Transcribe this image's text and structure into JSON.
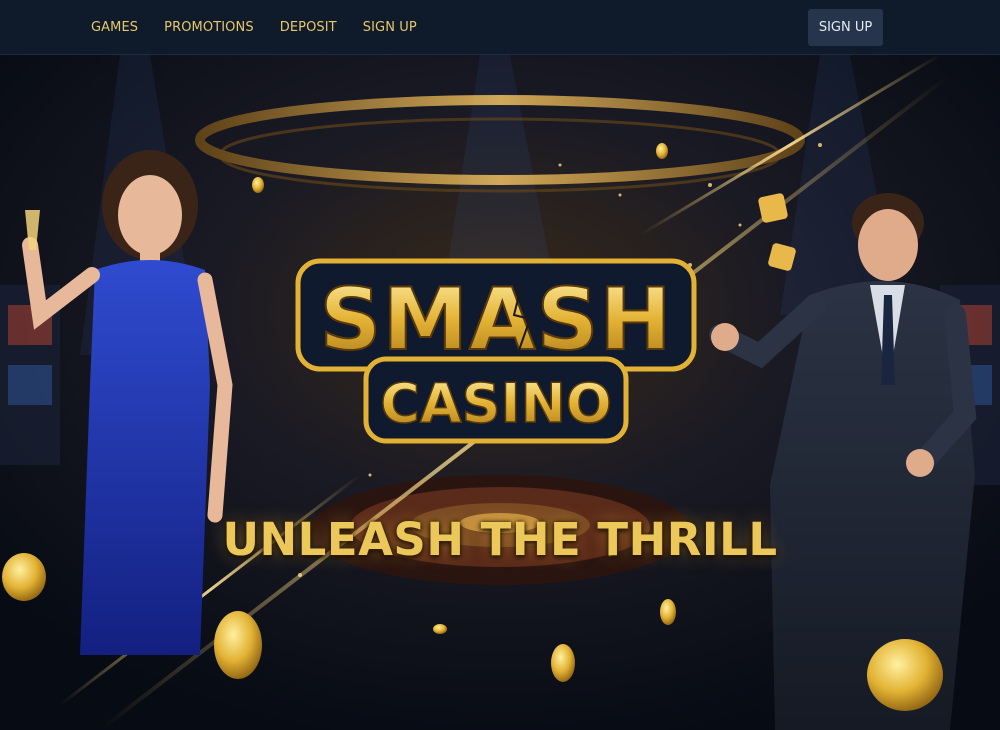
{
  "nav": {
    "items": [
      "GAMES",
      "PROMOTIONS",
      "DEPOSIT",
      "SIGN UP"
    ],
    "signup_button": "SIGN UP"
  },
  "hero": {
    "logo_line1": "SMASH",
    "logo_line2": "CASINO",
    "tagline": "UNLEASH THE THRILL"
  },
  "colors": {
    "gold": "#ecc75a",
    "navy": "#0f1a2a",
    "button": "#26354c"
  }
}
